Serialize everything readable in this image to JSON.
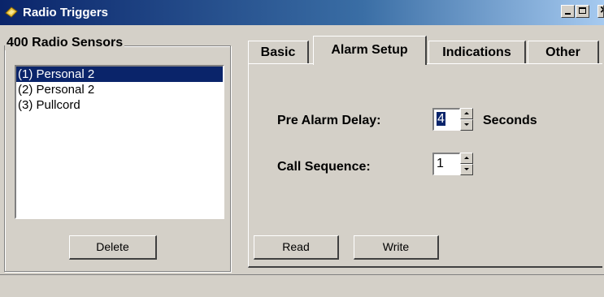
{
  "window": {
    "title": "Radio Triggers",
    "app_icon": "radio-trigger-icon"
  },
  "sensors": {
    "group_title": "400 Radio Sensors",
    "items": [
      {
        "label": "(1) Personal 2",
        "selected": true
      },
      {
        "label": "(2) Personal 2",
        "selected": false
      },
      {
        "label": "(3) Pullcord",
        "selected": false
      }
    ],
    "delete_label": "Delete"
  },
  "tabs": [
    {
      "label": "Basic",
      "active": false
    },
    {
      "label": "Alarm Setup",
      "active": true
    },
    {
      "label": "Indications",
      "active": false
    },
    {
      "label": "Other",
      "active": false
    }
  ],
  "alarm_setup": {
    "pre_alarm_label": "Pre Alarm Delay:",
    "pre_alarm_value": "4",
    "pre_alarm_unit": "Seconds",
    "call_sequence_label": "Call Sequence:",
    "call_sequence_value": "1",
    "read_label": "Read",
    "write_label": "Write"
  },
  "colors": {
    "titlebar_start": "#0a246a",
    "selection": "#0a246a",
    "face": "#d4d0c8"
  }
}
